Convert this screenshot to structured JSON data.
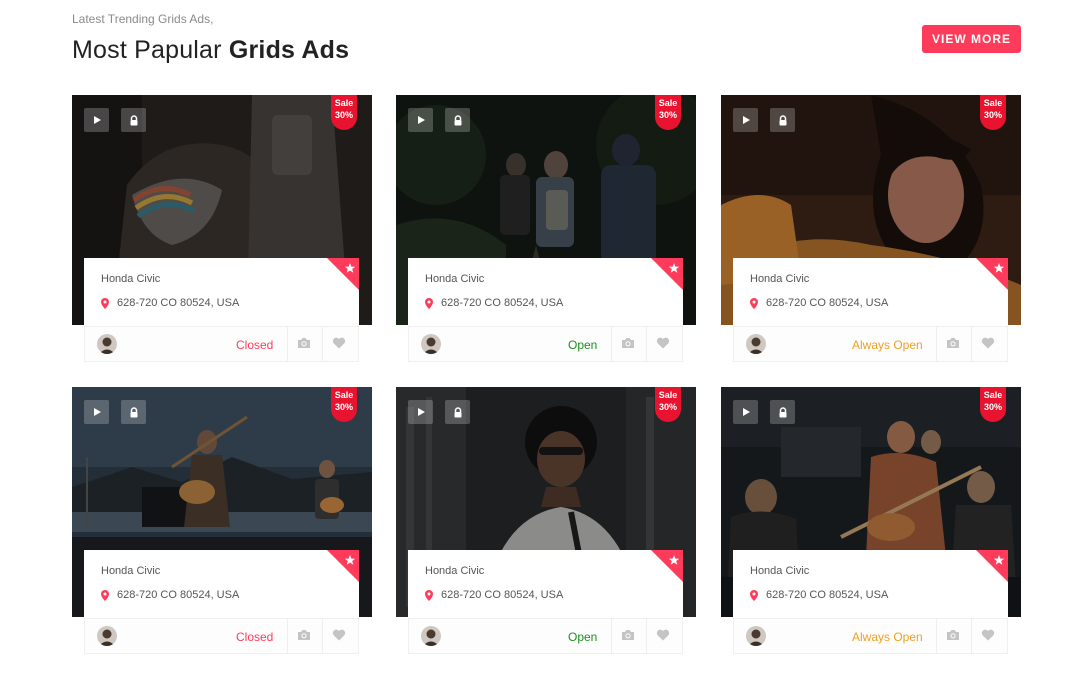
{
  "header": {
    "eyebrow": "Latest Trending Grids Ads,",
    "title_light": "Most Papular",
    "title_bold": "Grids Ads",
    "view_more_label": "VIEW MORE"
  },
  "colors": {
    "accent": "#fe3b5a",
    "sale_badge": "#e8132e",
    "status_closed": "#fe3b5a",
    "status_open": "#1e8e1e",
    "status_always_open": "#f0a020"
  },
  "cards": [
    {
      "sale_line1": "Sale",
      "sale_line2": "30%",
      "title": "Honda Civic",
      "address": "628-720 CO 80524, USA",
      "status": "Closed",
      "status_color": "#fe3b5a",
      "photo": "woman-with-backpack-photo"
    },
    {
      "sale_line1": "Sale",
      "sale_line2": "30%",
      "title": "Honda Civic",
      "address": "628-720 CO 80524, USA",
      "status": "Open",
      "status_color": "#1e8e1e",
      "photo": "hikers-in-forest-photo"
    },
    {
      "sale_line1": "Sale",
      "sale_line2": "30%",
      "title": "Honda Civic",
      "address": "628-720 CO 80524, USA",
      "status": "Always Open",
      "status_color": "#f0a020",
      "photo": "woman-sleeping-photo"
    },
    {
      "sale_line1": "Sale",
      "sale_line2": "30%",
      "title": "Honda Civic",
      "address": "628-720 CO 80524, USA",
      "status": "Closed",
      "status_color": "#fe3b5a",
      "photo": "musicians-on-stage-photo"
    },
    {
      "sale_line1": "Sale",
      "sale_line2": "30%",
      "title": "Honda Civic",
      "address": "628-720 CO 80524, USA",
      "status": "Open",
      "status_color": "#1e8e1e",
      "photo": "man-with-sunglasses-photo"
    },
    {
      "sale_line1": "Sale",
      "sale_line2": "30%",
      "title": "Honda Civic",
      "address": "628-720 CO 80524, USA",
      "status": "Always Open",
      "status_color": "#f0a020",
      "photo": "guitarist-playing-photo"
    }
  ],
  "icons": {
    "play": "play-icon",
    "lock": "lock-icon",
    "star": "star-icon",
    "pin": "location-pin-icon",
    "camera": "camera-icon",
    "heart": "heart-icon"
  }
}
